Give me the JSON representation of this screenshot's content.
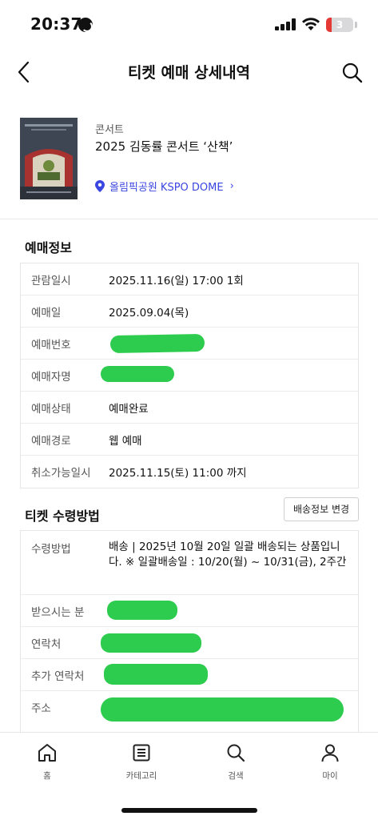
{
  "status_bar": {
    "time": "20:37",
    "battery_level": "3",
    "battery_color": "#e53935"
  },
  "header": {
    "title": "티켓 예매 상세내역"
  },
  "event": {
    "category": "콘서트",
    "title": "2025 김동률 콘서트 ‘산책’",
    "venue": "올림픽공원 KSPO DOME",
    "venue_chevron": "›",
    "accent_color": "#3a46e0"
  },
  "booking_info": {
    "heading": "예매정보",
    "rows": [
      {
        "label": "관람일시",
        "value": "2025.11.16(일) 17:00 1회"
      },
      {
        "label": "예매일",
        "value": "2025.09.04(목)"
      },
      {
        "label": "예매번호",
        "value": ""
      },
      {
        "label": "예매자명",
        "value": ""
      },
      {
        "label": "예매상태",
        "value": "예매완료"
      },
      {
        "label": "예매경로",
        "value": "웹 예매"
      },
      {
        "label": "취소가능일시",
        "value": "2025.11.15(토) 11:00 까지"
      }
    ]
  },
  "delivery_info": {
    "heading": "티켓 수령방법",
    "change_button": "배송정보 변경",
    "rows": [
      {
        "label": "수령방법",
        "value": "배송 | 2025년 10월 20일 일괄 배송되는 상품입니다. ※ 일괄배송일 : 10/20(월) ~ 10/31(금), 2주간"
      },
      {
        "label": "받으시는 분",
        "value": ""
      },
      {
        "label": "연락처",
        "value": ""
      },
      {
        "label": "추가 연락처",
        "value": ""
      },
      {
        "label": "주소",
        "value": ""
      }
    ]
  },
  "redaction_color": "#2dcc4e",
  "bottom_nav": [
    {
      "label": "홈",
      "icon": "home-icon"
    },
    {
      "label": "카테고리",
      "icon": "category-list-icon"
    },
    {
      "label": "검색",
      "icon": "search-icon"
    },
    {
      "label": "마이",
      "icon": "person-icon"
    }
  ]
}
